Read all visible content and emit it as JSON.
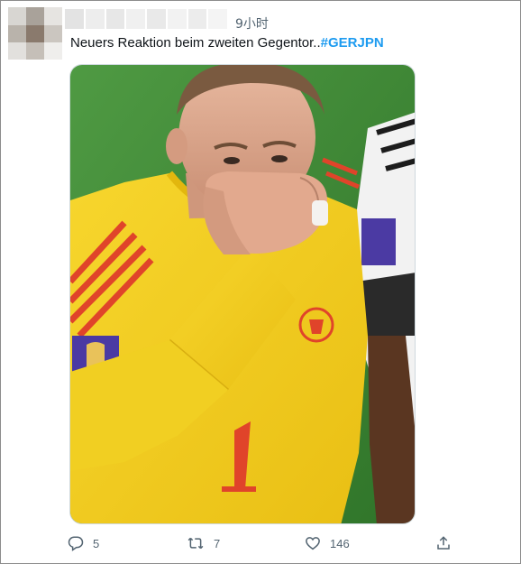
{
  "tweet": {
    "timestamp": "9小时",
    "text_prefix": "Neuers Reaktion beim zweiten Gegentor..",
    "hashtag": "#GERJPN"
  },
  "actions": {
    "reply": {
      "icon": "reply-icon",
      "count": "5"
    },
    "retweet": {
      "icon": "retweet-icon",
      "count": "7"
    },
    "like": {
      "icon": "heart-icon",
      "count": "146"
    },
    "share": {
      "icon": "share-icon"
    }
  },
  "colors": {
    "hashtag": "#1d9bf0",
    "secondary_text": "#536471",
    "primary_text": "#0f1419",
    "jersey": "#f5cf1f",
    "pitch": "#3f8a34"
  }
}
